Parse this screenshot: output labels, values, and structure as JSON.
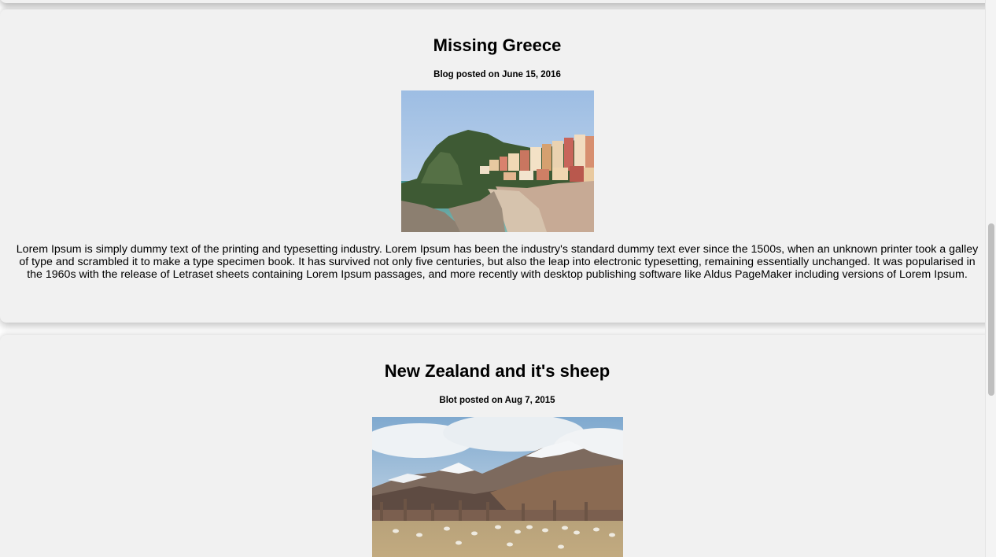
{
  "posts": [
    {
      "title": "Missing Greece",
      "date": "Blog posted on June 15, 2016",
      "image": "greek-coastal-village-photo",
      "body": "Lorem Ipsum is simply dummy text of the printing and typesetting industry. Lorem Ipsum has been the industry's standard dummy text ever since the 1500s, when an unknown printer took a galley of type and scrambled it to make a type specimen book. It has survived not only five centuries, but also the leap into electronic typesetting, remaining essentially unchanged. It was popularised in the 1960s with the release of Letraset sheets containing Lorem Ipsum passages, and more recently with desktop publishing software like Aldus PageMaker including versions of Lorem Ipsum."
    },
    {
      "title": "New Zealand and it's sheep",
      "date": "Blot posted on Aug 7, 2015",
      "image": "mountain-pasture-sheep-photo"
    }
  ],
  "colors": {
    "card_background": "#f1f1f1",
    "page_background": "#ffffff",
    "scrollbar_thumb": "#bfbfbf"
  }
}
